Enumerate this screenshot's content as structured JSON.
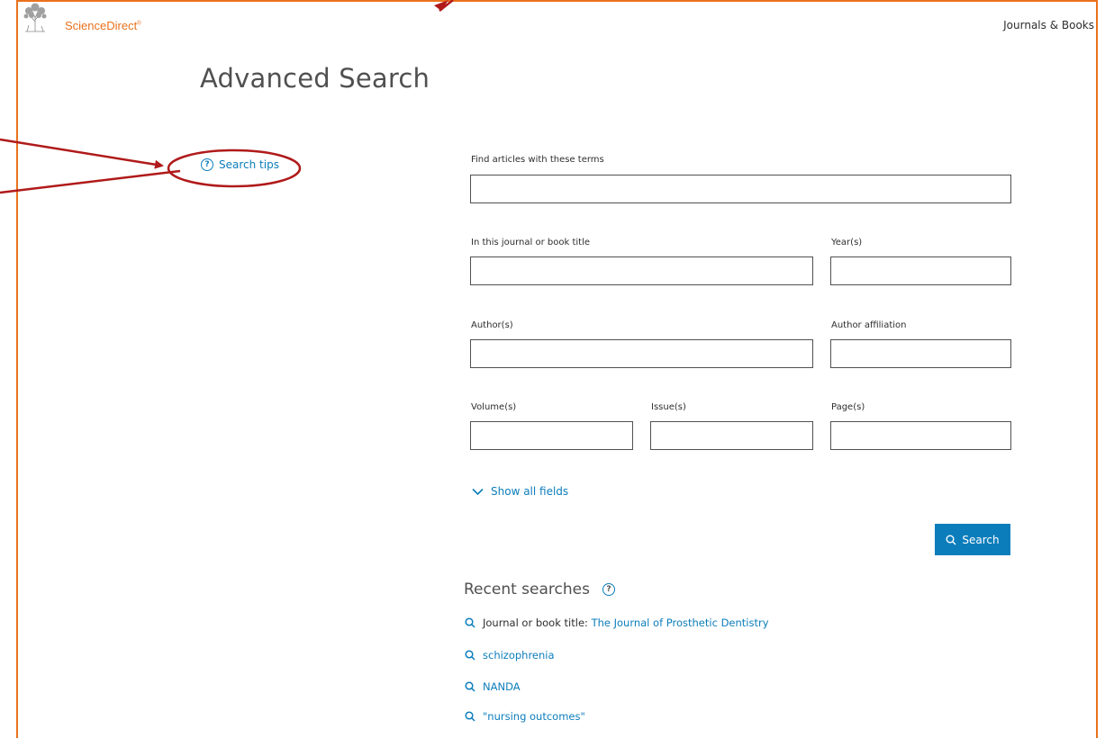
{
  "header": {
    "brand": "ScienceDirect",
    "brand_mark": "®",
    "nav_right": "Journals & Books"
  },
  "page_title": "Advanced Search",
  "search_tips": {
    "label": "Search tips",
    "icon": "question-circle-icon"
  },
  "form": {
    "terms_label": "Find articles with these terms",
    "journal_label": "In this journal or book title",
    "year_label": "Year(s)",
    "author_label": "Author(s)",
    "affiliation_label": "Author affiliation",
    "volume_label": "Volume(s)",
    "issue_label": "Issue(s)",
    "page_label": "Page(s)",
    "terms_value": "",
    "journal_value": "",
    "year_value": "",
    "author_value": "",
    "affiliation_value": "",
    "volume_value": "",
    "issue_value": "",
    "page_value": ""
  },
  "show_all_fields": "Show all fields",
  "search_button": "Search",
  "recent": {
    "title": "Recent searches",
    "items": [
      {
        "prefix": "Journal or book title:",
        "text": "The Journal of Prosthetic Dentistry"
      },
      {
        "prefix": "",
        "text": "schizophrenia"
      },
      {
        "prefix": "",
        "text": "NANDA"
      },
      {
        "prefix": "",
        "text": "\"nursing outcomes\""
      }
    ]
  },
  "colors": {
    "accent_orange": "#e9711c",
    "link_blue": "#0c7dbb",
    "annotation_red": "#b01a1a"
  }
}
